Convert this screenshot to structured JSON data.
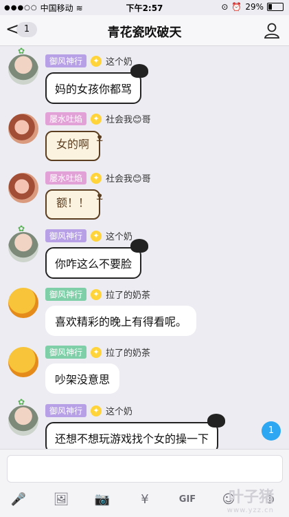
{
  "status": {
    "carrier": "中国移动",
    "time": "下午2:57",
    "battery": "29%",
    "battery_level": 0.29
  },
  "nav": {
    "back_badge": "1",
    "title": "青花瓷吹破天"
  },
  "messages": [
    {
      "title": "御风神行",
      "name": "这个奶",
      "text": "妈的女孩你都骂"
    },
    {
      "title": "屡水吐焰",
      "name": "社会我😊哥",
      "text": "女的啊"
    },
    {
      "title": "屡水吐焰",
      "name": "社会我😊哥",
      "text": "额！！"
    },
    {
      "title": "御风神行",
      "name": "这个奶",
      "text": "你咋这么不要脸"
    },
    {
      "title": "御风神行",
      "name": "拉了的奶茶",
      "text": "喜欢精彩的晚上有得看呢。"
    },
    {
      "title": "御风神行",
      "name": "拉了的奶茶",
      "text": "吵架没意思"
    },
    {
      "title": "御风神行",
      "name": "这个奶",
      "text": "还想不想玩游戏找个女的操一下"
    }
  ],
  "floating_unread": "1",
  "toolbar": {
    "gif_label": "GIF"
  },
  "watermark": {
    "main": "叶子猪",
    "url": "www.yzz.cn"
  },
  "colors": {
    "blue_accent": "#2da7f2",
    "badge_purple": "#b7a0e6",
    "badge_pink": "#e3a2d7",
    "badge_green": "#7fd0a8"
  }
}
